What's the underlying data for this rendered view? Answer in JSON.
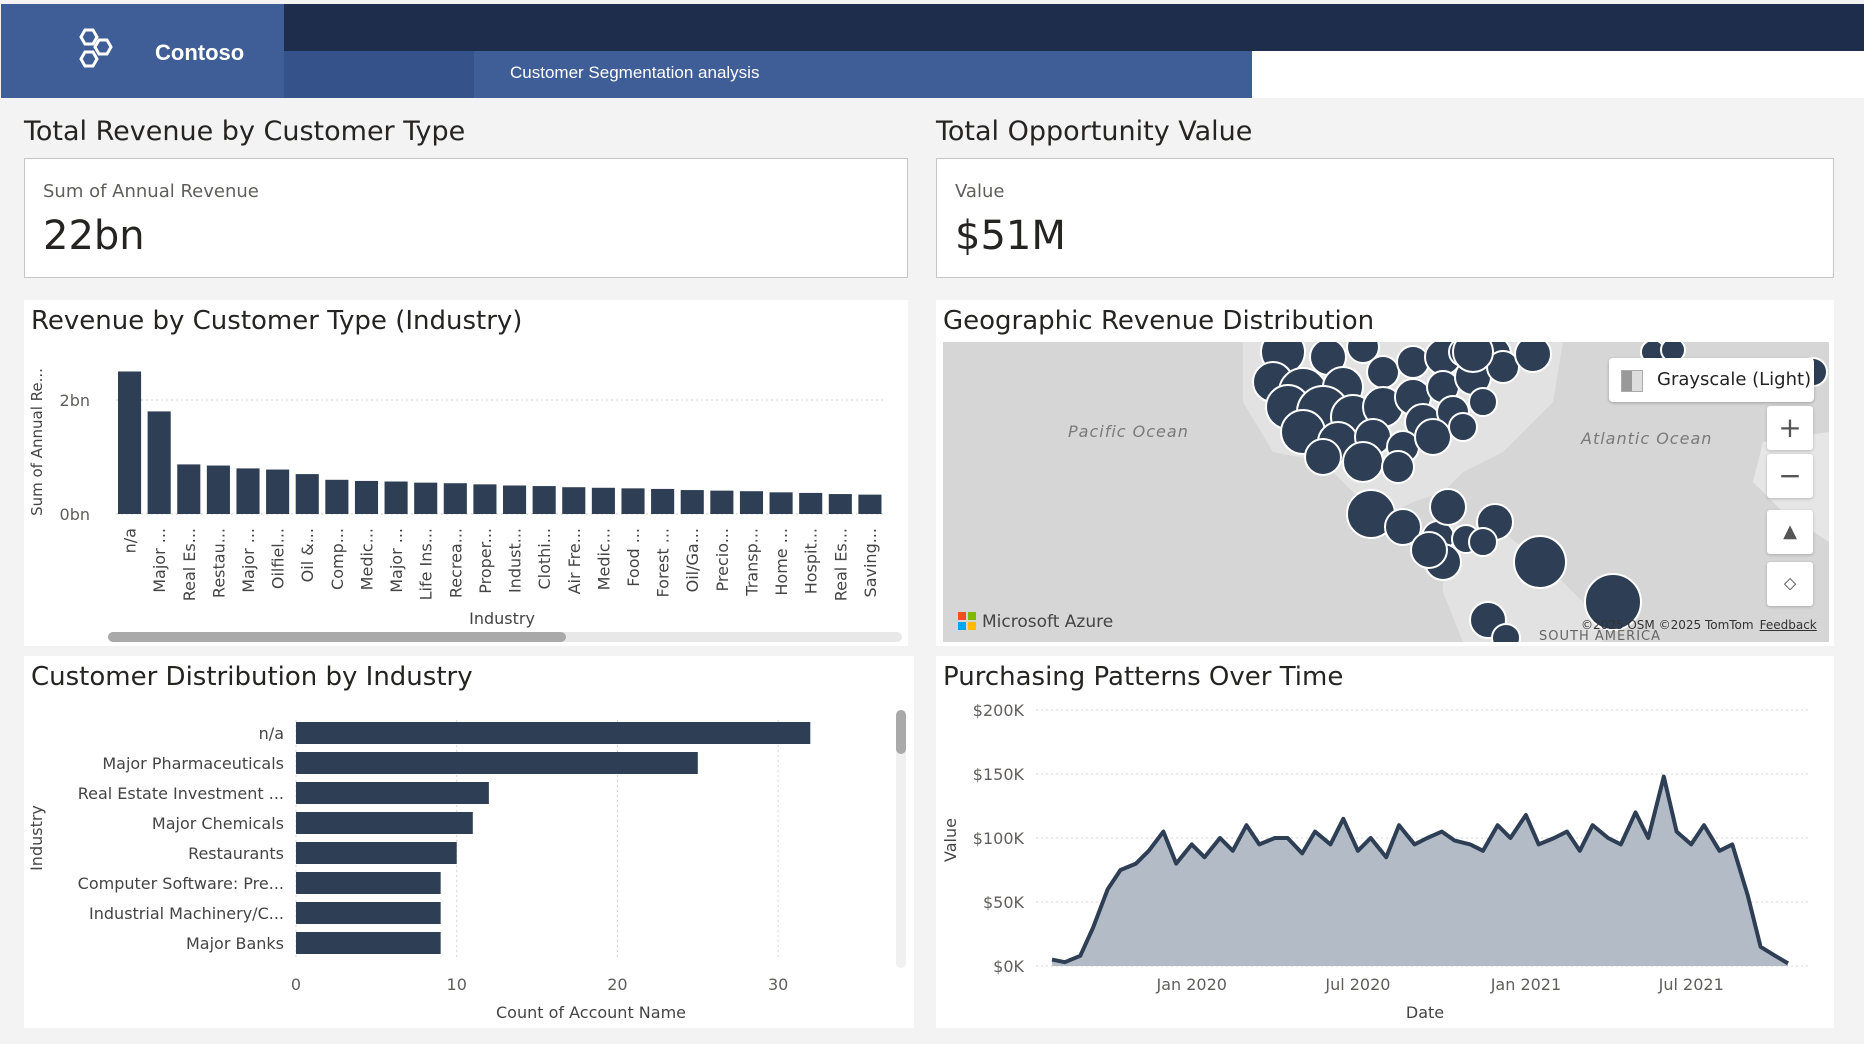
{
  "header": {
    "brand": "Contoso",
    "tab_label": "Customer Segmentation analysis"
  },
  "sections": {
    "revenue_title": "Total Revenue by Customer Type",
    "opportunity_title": "Total Opportunity Value"
  },
  "cards": {
    "revenue": {
      "label": "Sum of Annual Revenue",
      "value": "22bn"
    },
    "opportunity": {
      "label": "Value",
      "value": "$51M"
    }
  },
  "panels": {
    "bar_title": "Revenue by Customer Type (Industry)",
    "map_title": "Geographic Revenue Distribution",
    "hbar_title": "Customer Distribution by Industry",
    "line_title": "Purchasing Patterns Over Time"
  },
  "map": {
    "ocean_pacific": "Pacific Ocean",
    "ocean_atlantic": "Atlantic Ocean",
    "style_label": "Grayscale (Light)",
    "zoom_in": "+",
    "zoom_out": "−",
    "provider": "Microsoft Azure",
    "copyright": "©2025 OSM ©2025 TomTom",
    "feedback": "Feedback",
    "region_label": "SOUTH AMERICA",
    "bubble_color": "#2e3f55"
  },
  "colors": {
    "bar": "#2e3f55",
    "area": "#b3bcc6",
    "header_dark": "#1f2d4d",
    "header_blue": "#3f5d96"
  },
  "chart_data": [
    {
      "type": "bar",
      "title": "Revenue by Customer Type (Industry)",
      "xlabel": "Industry",
      "ylabel": "Sum of Annual Re...",
      "ylim": [
        0,
        2.5
      ],
      "yticks": [
        {
          "v": 0,
          "label": "0bn"
        },
        {
          "v": 2,
          "label": "2bn"
        }
      ],
      "categories": [
        "n/a",
        "Major ...",
        "Real Es...",
        "Restau...",
        "Major ...",
        "Oilfiel...",
        "Oil &...",
        "Comp...",
        "Medic...",
        "Major ...",
        "Life Ins...",
        "Recrea...",
        "Proper...",
        "Indust...",
        "Clothi...",
        "Air Fre...",
        "Medic...",
        "Food ...",
        "Forest ...",
        "Oil/Ga...",
        "Precio...",
        "Transp...",
        "Home ...",
        "Hospit...",
        "Real Es...",
        "Saving..."
      ],
      "values": [
        2.5,
        1.8,
        0.87,
        0.85,
        0.8,
        0.78,
        0.7,
        0.6,
        0.58,
        0.57,
        0.55,
        0.54,
        0.52,
        0.5,
        0.49,
        0.47,
        0.46,
        0.45,
        0.44,
        0.42,
        0.41,
        0.4,
        0.38,
        0.37,
        0.35,
        0.34
      ],
      "grid": true
    },
    {
      "type": "bar",
      "orientation": "horizontal",
      "title": "Customer Distribution by Industry",
      "xlabel": "Count of Account Name",
      "ylabel": "Industry",
      "xlim": [
        0,
        35
      ],
      "xticks": [
        0,
        10,
        20,
        30
      ],
      "categories": [
        "n/a",
        "Major Pharmaceuticals",
        "Real Estate Investment ...",
        "Major Chemicals",
        "Restaurants",
        "Computer Software: Pre...",
        "Industrial Machinery/C...",
        "Major Banks"
      ],
      "values": [
        32,
        25,
        12,
        11,
        10,
        9,
        9,
        9
      ],
      "grid": true
    },
    {
      "type": "area",
      "title": "Purchasing Patterns Over Time",
      "xlabel": "Date",
      "ylabel": "Value",
      "ylim": [
        0,
        200000
      ],
      "yticks": [
        {
          "v": 0,
          "label": "$0K"
        },
        {
          "v": 50000,
          "label": "$50K"
        },
        {
          "v": 100000,
          "label": "$100K"
        },
        {
          "v": 150000,
          "label": "$150K"
        },
        {
          "v": 200000,
          "label": "$200K"
        }
      ],
      "xticks": [
        {
          "d": "2020-01-01",
          "label": "Jan 2020"
        },
        {
          "d": "2020-07-01",
          "label": "Jul 2020"
        },
        {
          "d": "2021-01-01",
          "label": "Jan 2021"
        },
        {
          "d": "2021-07-01",
          "label": "Jul 2021"
        }
      ],
      "x_range": [
        "2019-08-01",
        "2021-10-15"
      ],
      "series": [
        {
          "x": [
            "2019-08-01",
            "2019-08-15",
            "2019-09-01",
            "2019-09-15",
            "2019-10-01",
            "2019-10-15",
            "2019-11-01",
            "2019-11-15",
            "2019-12-01",
            "2019-12-15",
            "2020-01-01",
            "2020-01-15",
            "2020-02-01",
            "2020-02-15",
            "2020-03-01",
            "2020-03-15",
            "2020-04-01",
            "2020-04-15",
            "2020-05-01",
            "2020-05-15",
            "2020-06-01",
            "2020-06-15",
            "2020-07-01",
            "2020-07-15",
            "2020-08-01",
            "2020-08-15",
            "2020-09-01",
            "2020-09-15",
            "2020-10-01",
            "2020-10-15",
            "2020-11-01",
            "2020-11-15",
            "2020-12-01",
            "2020-12-15",
            "2021-01-01",
            "2021-01-15",
            "2021-02-01",
            "2021-02-15",
            "2021-03-01",
            "2021-03-15",
            "2021-04-01",
            "2021-04-15",
            "2021-05-01",
            "2021-05-15",
            "2021-06-01",
            "2021-06-15",
            "2021-07-01",
            "2021-07-15",
            "2021-08-01",
            "2021-08-15",
            "2021-09-01",
            "2021-09-15",
            "2021-10-01",
            "2021-10-15"
          ],
          "values": [
            5000,
            3000,
            8000,
            30000,
            60000,
            75000,
            80000,
            90000,
            105000,
            80000,
            95000,
            85000,
            100000,
            90000,
            110000,
            95000,
            100000,
            100000,
            88000,
            105000,
            95000,
            115000,
            90000,
            100000,
            85000,
            110000,
            95000,
            100000,
            105000,
            98000,
            95000,
            90000,
            110000,
            100000,
            118000,
            95000,
            100000,
            105000,
            90000,
            110000,
            100000,
            95000,
            120000,
            100000,
            148000,
            105000,
            95000,
            110000,
            90000,
            95000,
            55000,
            15000,
            8000,
            2000
          ]
        }
      ]
    }
  ]
}
